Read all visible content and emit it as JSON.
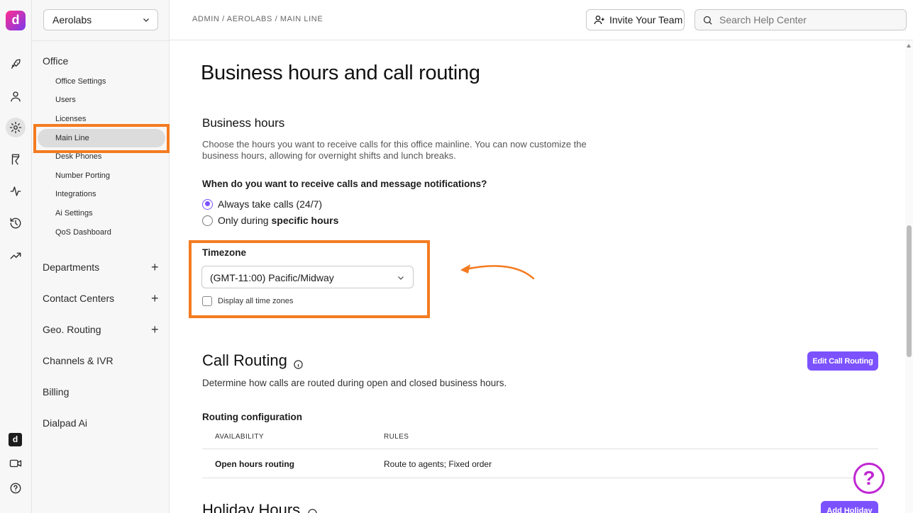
{
  "rail": {
    "logo_letter": "d",
    "mini_logo_letter": "d"
  },
  "sidebar": {
    "org_name": "Aerolabs",
    "office": {
      "title": "Office",
      "items": [
        "Office Settings",
        "Users",
        "Licenses",
        "Main Line",
        "Desk Phones",
        "Number Porting",
        "Integrations",
        "Ai Settings",
        "QoS Dashboard"
      ],
      "active_index": 3
    },
    "sections": [
      "Departments",
      "Contact Centers",
      "Geo. Routing",
      "Channels & IVR",
      "Billing",
      "Dialpad Ai"
    ]
  },
  "topbar": {
    "breadcrumb": "ADMIN / AEROLABS / MAIN LINE",
    "invite_label": "Invite Your Team",
    "search_placeholder": "Search Help Center"
  },
  "page": {
    "title": "Business hours and call routing",
    "business_hours": {
      "heading": "Business hours",
      "description": "Choose the hours you want to receive calls for this office mainline. You can now customize the business hours, allowing for overnight shifts and lunch breaks.",
      "question": "When do you want to receive calls and message notifications?",
      "option_always": "Always take calls (24/7)",
      "option_specific_prefix": "Only during ",
      "option_specific_bold": "specific hours",
      "selected": "always",
      "timezone_label": "Timezone",
      "timezone_value": "(GMT-11:00) Pacific/Midway",
      "display_all_label": "Display all time zones",
      "display_all_checked": false
    },
    "call_routing": {
      "heading": "Call Routing",
      "edit_button": "Edit Call Routing",
      "description": "Determine how calls are routed during open and closed business hours.",
      "config_title": "Routing configuration",
      "columns": [
        "AVAILABILITY",
        "RULES"
      ],
      "rows": [
        {
          "availability": "Open hours routing",
          "rules": "Route to agents; Fixed order"
        }
      ]
    },
    "holiday_hours": {
      "heading": "Holiday Hours",
      "add_button": "Add Holiday"
    }
  },
  "colors": {
    "accent": "#7c52ff",
    "highlight": "#f47b20",
    "help": "#c026d3"
  },
  "help_fab_glyph": "?"
}
